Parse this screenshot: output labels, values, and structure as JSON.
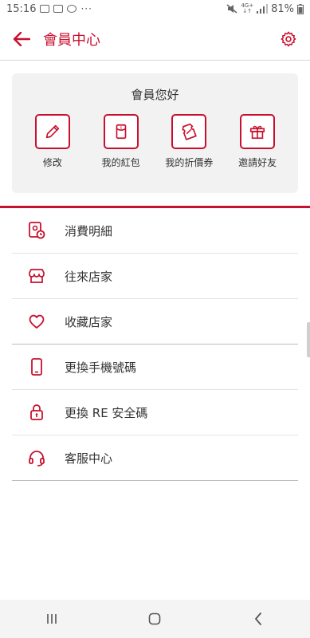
{
  "status_bar": {
    "time": "15:16",
    "more": "···",
    "network_top": "4G+",
    "network_bottom": "↓↑",
    "battery": "81%"
  },
  "app_bar": {
    "title": "會員中心",
    "back_icon": "arrow-left-icon",
    "settings_icon": "gear-icon"
  },
  "member_card": {
    "greeting": "會員您好",
    "actions": [
      {
        "label": "修改",
        "icon": "pencil-icon"
      },
      {
        "label": "我的紅包",
        "icon": "red-envelope-icon"
      },
      {
        "label": "我的折價券",
        "icon": "coupon-icon"
      },
      {
        "label": "邀請好友",
        "icon": "gift-icon"
      }
    ]
  },
  "menu": [
    {
      "label": "消費明細",
      "icon": "receipt-clock-icon"
    },
    {
      "label": "往來店家",
      "icon": "store-icon"
    },
    {
      "label": "收藏店家",
      "icon": "heart-icon"
    },
    {
      "label": "更換手機號碼",
      "icon": "phone-icon"
    },
    {
      "label": "更換 RE 安全碼",
      "icon": "lock-icon"
    },
    {
      "label": "客服中心",
      "icon": "headset-icon"
    }
  ],
  "nav_bar": {
    "recents_icon": "recents-icon",
    "home_icon": "home-icon",
    "back_icon": "back-chevron-icon"
  },
  "colors": {
    "brand": "#c8102e",
    "card_bg": "#f2f2f2",
    "text": "#333333"
  }
}
